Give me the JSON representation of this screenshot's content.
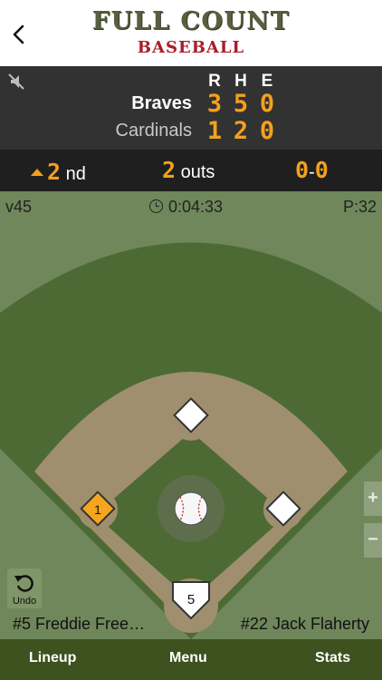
{
  "header": {
    "logo_line1": "FULL COUNT",
    "logo_line2": "BASEBALL",
    "back_icon": "chevron-left-icon"
  },
  "scoreboard": {
    "mute_icon": "mute-icon",
    "columns": [
      "R",
      "H",
      "E"
    ],
    "away": {
      "name": "Braves",
      "r": "3",
      "h": "5",
      "e": "0"
    },
    "home": {
      "name": "Cardinals",
      "r": "1",
      "h": "2",
      "e": "0"
    }
  },
  "status": {
    "inning_number": "2",
    "inning_suffix": "nd",
    "outs_number": "2",
    "outs_label": "outs",
    "balls": "0",
    "strikes": "0",
    "count_separator": "-"
  },
  "info": {
    "version": "v45",
    "time": "0:04:33",
    "pitch_count": "P:32"
  },
  "field": {
    "first_base_runner": "1",
    "home_batter": "5"
  },
  "controls": {
    "zoom_in": "+",
    "zoom_out": "−",
    "undo_label": "Undo"
  },
  "players": {
    "batter": "#5 Freddie Free…",
    "pitcher": "#22 Jack Flaherty"
  },
  "tabs": {
    "lineup": "Lineup",
    "menu": "Menu",
    "stats": "Stats"
  },
  "colors": {
    "accent": "#f2a11f",
    "brand_red": "#a81e2a",
    "grass": "#4d6a34",
    "dirt": "#a08f6e",
    "tabbar": "#3d521f"
  }
}
